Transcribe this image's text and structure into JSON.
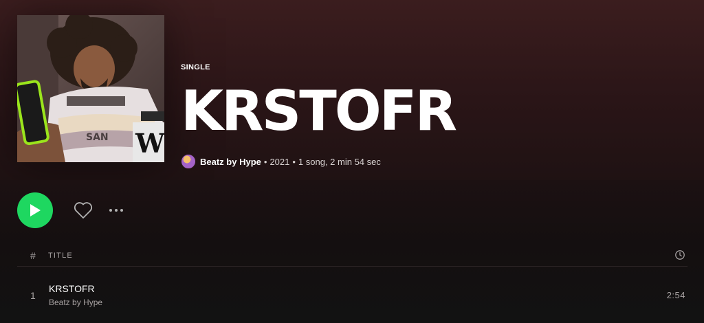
{
  "album": {
    "type_label": "SINGLE",
    "title": "KRSTOFR",
    "artist": "Beatz by Hype",
    "separator": "•",
    "year": "2021",
    "summary": "1 song, 2 min 54 sec"
  },
  "actions": {
    "play_icon": "play-icon",
    "like_icon": "heart-icon",
    "more_icon": "more-options-icon"
  },
  "tracklist": {
    "header": {
      "number": "#",
      "title": "TITLE",
      "duration_icon": "clock-icon"
    },
    "tracks": [
      {
        "number": "1",
        "title": "KRSTOFR",
        "artist": "Beatz by Hype",
        "duration": "2:54"
      }
    ]
  },
  "colors": {
    "accent": "#1ed760",
    "header_bg": "#3b1d1e",
    "body_bg": "#121212"
  }
}
